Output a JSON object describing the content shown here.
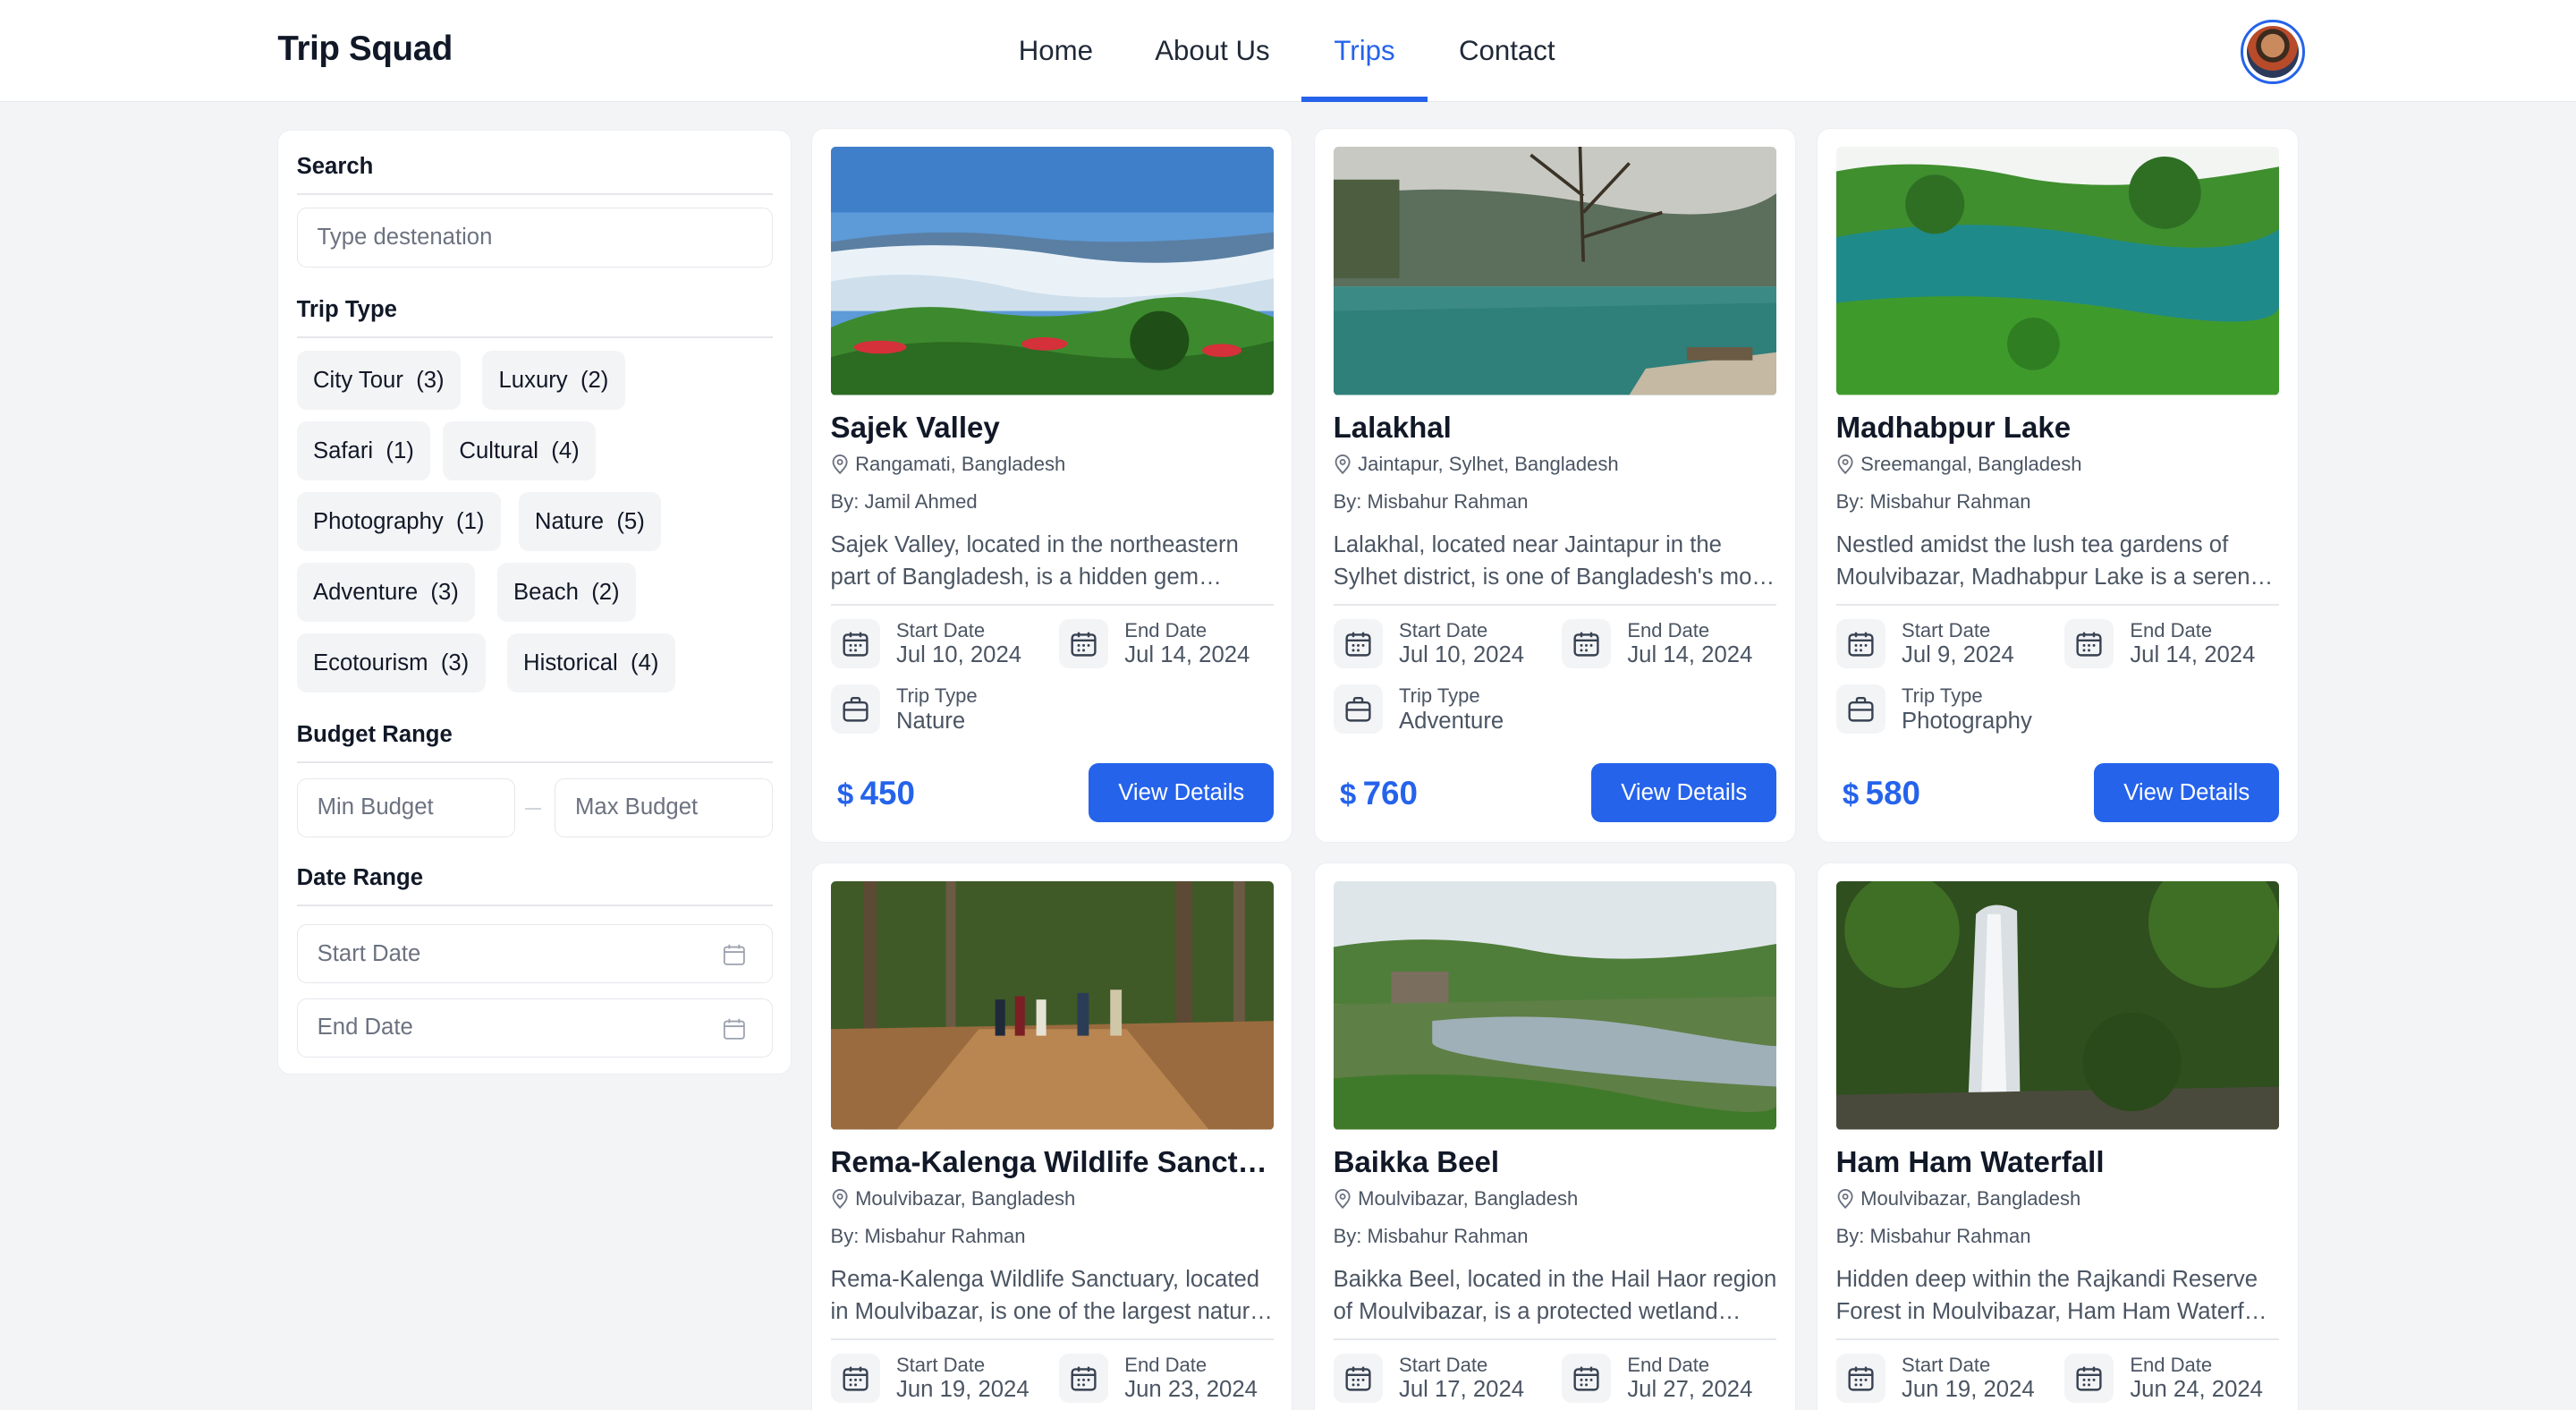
{
  "app": {
    "title": "Trip Squad"
  },
  "nav": {
    "items": [
      {
        "label": "Home",
        "active": false
      },
      {
        "label": "About Us",
        "active": false
      },
      {
        "label": "Trips",
        "active": true
      },
      {
        "label": "Contact",
        "active": false
      }
    ],
    "active_color": "#2563eb"
  },
  "sidebar": {
    "search": {
      "title": "Search",
      "placeholder": "Type destenation"
    },
    "trip_type": {
      "title": "Trip Type",
      "chips": [
        {
          "label": "City Tour",
          "count": "(3)"
        },
        {
          "label": "Luxury",
          "count": "(2)"
        },
        {
          "label": "Safari",
          "count": "(1)"
        },
        {
          "label": "Cultural",
          "count": "(4)"
        },
        {
          "label": "Photography",
          "count": "(1)"
        },
        {
          "label": "Nature",
          "count": "(5)"
        },
        {
          "label": "Adventure",
          "count": "(3)"
        },
        {
          "label": "Beach",
          "count": "(2)"
        },
        {
          "label": "Ecotourism",
          "count": "(3)"
        },
        {
          "label": "Historical",
          "count": "(4)"
        }
      ]
    },
    "budget": {
      "title": "Budget Range",
      "min_placeholder": "Min Budget",
      "max_placeholder": "Max Budget"
    },
    "dates": {
      "title": "Date Range",
      "start_placeholder": "Start Date",
      "end_placeholder": "End Date"
    }
  },
  "labels": {
    "start_date": "Start Date",
    "end_date": "End Date",
    "trip_type": "Trip Type",
    "view_details": "View Details",
    "currency": "$"
  },
  "trips": [
    {
      "title": "Sajek Valley",
      "location": "Rangamati, Bangladesh",
      "by": "By: Jamil Ahmed",
      "description": "Sajek Valley, located in the northeastern part of Bangladesh, is a hidden gem nestled in the hills.",
      "start": "Jul 10, 2024",
      "end": "Jul 14, 2024",
      "type": "Nature",
      "price": "450",
      "image": "mountain-clouds"
    },
    {
      "title": "Lalakhal",
      "location": "Jaintapur, Sylhet, Bangladesh",
      "by": "By: Misbahur Rahman",
      "description": "Lalakhal, located near Jaintapur in the Sylhet district, is one of Bangladesh's most beautiful rivers.",
      "start": "Jul 10, 2024",
      "end": "Jul 14, 2024",
      "type": "Adventure",
      "price": "760",
      "image": "river-tree"
    },
    {
      "title": "Madhabpur Lake",
      "location": "Sreemangal, Bangladesh",
      "by": "By: Misbahur Rahman",
      "description": "Nestled amidst the lush tea gardens of Moulvibazar, Madhabpur Lake is a serene destination.",
      "start": "Jul 9, 2024",
      "end": "Jul 14, 2024",
      "type": "Photography",
      "price": "580",
      "image": "green-lake"
    },
    {
      "title": "Rema-Kalenga Wildlife Sanctuary",
      "location": "Moulvibazar, Bangladesh",
      "by": "By: Misbahur Rahman",
      "description": "Rema-Kalenga Wildlife Sanctuary, located in Moulvibazar, is one of the largest natural forests.",
      "start": "Jun 19, 2024",
      "end": "Jun 23, 2024",
      "type": "",
      "price": "",
      "image": "forest-trail"
    },
    {
      "title": "Baikka Beel",
      "location": "Moulvibazar, Bangladesh",
      "by": "By: Misbahur Rahman",
      "description": "Baikka Beel, located in the Hail Haor region of Moulvibazar, is a protected wetland sanctuary.",
      "start": "Jul 17, 2024",
      "end": "Jul 27, 2024",
      "type": "",
      "price": "",
      "image": "wetland"
    },
    {
      "title": "Ham Ham Waterfall",
      "location": "Moulvibazar, Bangladesh",
      "by": "By: Misbahur Rahman",
      "description": "Hidden deep within the Rajkandi Reserve Forest in Moulvibazar, Ham Ham Waterfall is a hidden treasure.",
      "start": "Jun 19, 2024",
      "end": "Jun 24, 2024",
      "type": "",
      "price": "",
      "image": "waterfall"
    }
  ]
}
